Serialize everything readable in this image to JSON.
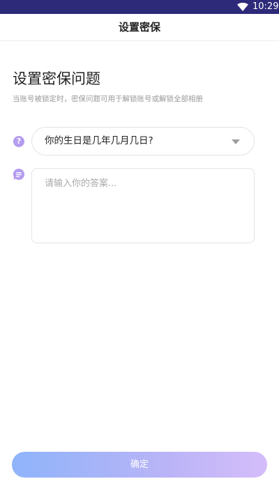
{
  "status_bar": {
    "time": "10:29",
    "wifi_icon": "wifi-icon",
    "background": "#2e2a7a"
  },
  "app_bar": {
    "title": "设置密保"
  },
  "main": {
    "heading": "设置密保问题",
    "subheading": "当账号被锁定时，密保问题可用于解锁账号或解锁全部相册",
    "question": {
      "icon": "question-icon",
      "icon_glyph": "?",
      "selected": "你的生日是几年几月几日?",
      "dropdown_icon": "caret-down-icon"
    },
    "answer": {
      "icon": "chat-icon",
      "value": "",
      "placeholder": "请输入你的答案..."
    }
  },
  "footer": {
    "confirm_label": "确定"
  },
  "colors": {
    "accent": "#b49cf0",
    "button_gradient_start": "#8fb4fa",
    "button_gradient_end": "#d5bdfa"
  }
}
